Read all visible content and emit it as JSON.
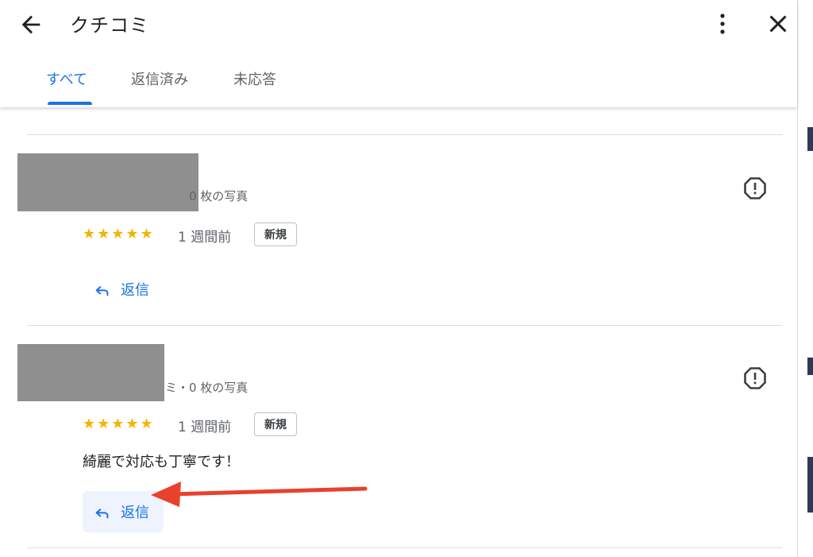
{
  "header": {
    "title": "クチコミ",
    "back_icon": "arrow-back-icon",
    "more_icon": "more-vert-icon",
    "close_icon": "close-icon"
  },
  "tabs": [
    {
      "label": "すべて",
      "active": true
    },
    {
      "label": "返信済み",
      "active": false
    },
    {
      "label": "未応答",
      "active": false
    }
  ],
  "reviews": [
    {
      "meta": "0 枚の写真",
      "stars": "★★★★★",
      "rating": 5,
      "time": "1 週間前",
      "badge": "新規",
      "text": "",
      "reply_label": "返信"
    },
    {
      "meta": "ミ・0 枚の写真",
      "stars": "★★★★★",
      "rating": 5,
      "time": "1 週間前",
      "badge": "新規",
      "text": "綺麗で対応も丁寧です！",
      "reply_label": "返信"
    }
  ],
  "colors": {
    "accent": "#1a73e8",
    "star": "#f4b400",
    "annotation_arrow": "#e8412c"
  }
}
